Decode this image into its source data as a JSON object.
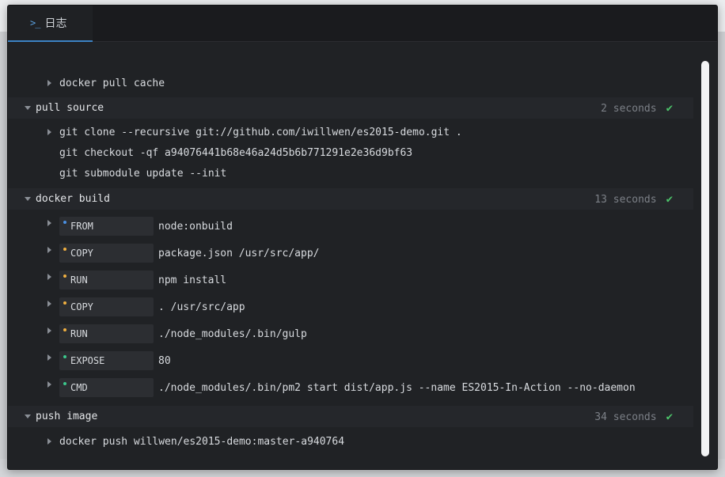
{
  "tab": {
    "icon": "terminal-icon",
    "glyph": ">_",
    "label": "日志"
  },
  "colors": {
    "accent": "#3b82c4",
    "success": "#4cc46a",
    "dot_blue": "#4a90e2",
    "dot_orange": "#f0b040",
    "dot_green": "#3cc88c"
  },
  "log": {
    "cache": {
      "label": "docker pull cache"
    },
    "pull": {
      "title": "pull source",
      "time": "2 seconds",
      "commands": [
        "git clone --recursive git://github.com/iwillwen/es2015-demo.git .",
        "git checkout -qf a94076441b68e46a24d5b6b771291e2e36d9bf63",
        "git submodule update --init"
      ]
    },
    "build": {
      "title": "docker build",
      "time": "13 seconds",
      "steps": [
        {
          "instr": "FROM",
          "arg": "node:onbuild",
          "dot": "blue"
        },
        {
          "instr": "COPY",
          "arg": "package.json /usr/src/app/",
          "dot": "orange"
        },
        {
          "instr": "RUN",
          "arg": "npm install",
          "dot": "orange"
        },
        {
          "instr": "COPY",
          "arg": ". /usr/src/app",
          "dot": "orange"
        },
        {
          "instr": "RUN",
          "arg": "./node_modules/.bin/gulp",
          "dot": "orange"
        },
        {
          "instr": "EXPOSE",
          "arg": "80",
          "dot": "green"
        },
        {
          "instr": "CMD",
          "arg": "./node_modules/.bin/pm2 start dist/app.js --name ES2015-In-Action --no-daemon",
          "dot": "green"
        }
      ]
    },
    "push": {
      "title": "push image",
      "time": "34 seconds",
      "commands": [
        "docker push willwen/es2015-demo:master-a940764"
      ]
    }
  }
}
